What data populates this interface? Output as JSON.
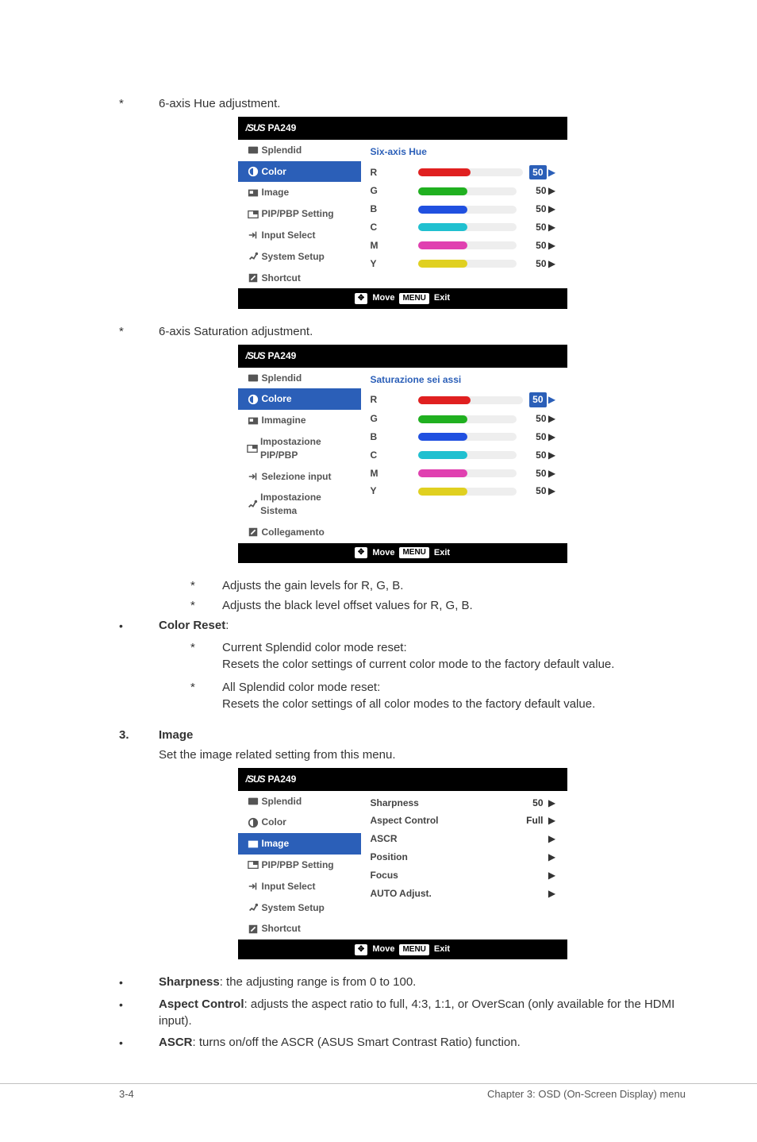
{
  "text": {
    "hue_adj": "6-axis Hue adjustment.",
    "sat_adj": "6-axis Saturation adjustment.",
    "gain_adj": "Adjusts the gain levels for R, G, B.",
    "black_adj": "Adjusts the black level offset values for R, G, B.",
    "color_reset_label": "Color Reset",
    "cr_current_head": "Current Splendid color mode reset:",
    "cr_current_body": "Resets the color settings of current color mode to the factory default value.",
    "cr_all_head": "All Splendid color mode reset:",
    "cr_all_body": "Resets the color settings of all color modes to the factory default value.",
    "section_num": "3.",
    "section_title": "Image",
    "section_desc": "Set the image related setting from this menu.",
    "sharp_label": "Sharpness",
    "sharp_desc": ": the adjusting range is from 0 to 100.",
    "aspect_label": "Aspect Control",
    "aspect_desc": ": adjusts the aspect ratio to full, 4:3, 1:1, or OverScan (only available for the HDMI input).",
    "ascr_label": "ASCR",
    "ascr_desc": ": turns on/off the ASCR (ASUS Smart Contrast Ratio) function."
  },
  "osd_model": "PA249",
  "osd_foot": {
    "move": "Move",
    "exit": "Exit",
    "menu_key": "MENU"
  },
  "osd1": {
    "pane_title": "Six-axis Hue",
    "side": [
      "Splendid",
      "Color",
      "Image",
      "PIP/PBP Setting",
      "Input Select",
      "System Setup",
      "Shortcut"
    ],
    "rows": [
      {
        "l": "R",
        "v": "50",
        "c": "c-r",
        "sel": true
      },
      {
        "l": "G",
        "v": "50",
        "c": "c-g"
      },
      {
        "l": "B",
        "v": "50",
        "c": "c-b"
      },
      {
        "l": "C",
        "v": "50",
        "c": "c-c"
      },
      {
        "l": "M",
        "v": "50",
        "c": "c-m"
      },
      {
        "l": "Y",
        "v": "50",
        "c": "c-y"
      }
    ]
  },
  "osd2": {
    "pane_title": "Saturazione sei assi",
    "side": [
      "Splendid",
      "Colore",
      "Immagine",
      "Impostazione PIP/PBP",
      "Selezione input",
      "Impostazione Sistema",
      "Collegamento"
    ],
    "rows": [
      {
        "l": "R",
        "v": "50",
        "c": "c-r",
        "sel": true
      },
      {
        "l": "G",
        "v": "50",
        "c": "c-g"
      },
      {
        "l": "B",
        "v": "50",
        "c": "c-b"
      },
      {
        "l": "C",
        "v": "50",
        "c": "c-c"
      },
      {
        "l": "M",
        "v": "50",
        "c": "c-m"
      },
      {
        "l": "Y",
        "v": "50",
        "c": "c-y"
      }
    ]
  },
  "osd3": {
    "side": [
      "Splendid",
      "Color",
      "Image",
      "PIP/PBP Setting",
      "Input Select",
      "System Setup",
      "Shortcut"
    ],
    "rows": [
      {
        "l": "Sharpness",
        "v": "50"
      },
      {
        "l": "Aspect Control",
        "v": "Full"
      },
      {
        "l": "ASCR",
        "v": ""
      },
      {
        "l": "Position",
        "v": ""
      },
      {
        "l": "Focus",
        "v": ""
      },
      {
        "l": "AUTO Adjust.",
        "v": ""
      }
    ]
  },
  "footer": {
    "left": "3-4",
    "right": "Chapter 3: OSD (On-Screen Display) menu"
  }
}
